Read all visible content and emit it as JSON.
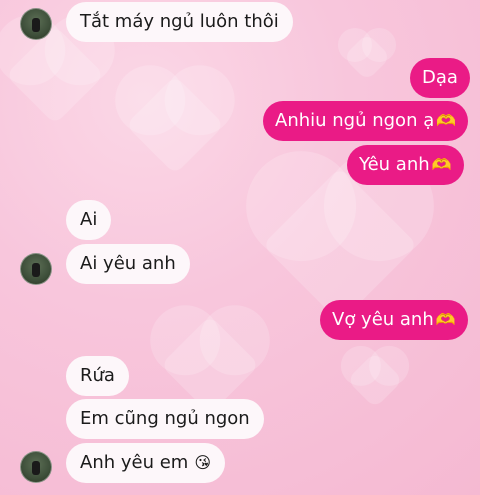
{
  "messages": [
    {
      "text": "Tắt máy ngủ luôn thôi",
      "side": "in"
    },
    {
      "text": "Dạa",
      "side": "out"
    },
    {
      "text": "Anhiu ngủ ngon ạ",
      "emoji": "🫶",
      "side": "out"
    },
    {
      "text": "Yêu anh",
      "emoji": "🫶",
      "side": "out"
    },
    {
      "text": "Ai",
      "side": "in"
    },
    {
      "text": "Ai yêu anh",
      "side": "in"
    },
    {
      "text": "Vợ yêu anh",
      "emoji": "🫶",
      "side": "out"
    },
    {
      "text": "Rứa",
      "side": "in"
    },
    {
      "text": "Em cũng ngủ ngon",
      "side": "in"
    },
    {
      "text": "Anh yêu em",
      "emoji": "😘",
      "side": "in"
    }
  ],
  "colors": {
    "outgoing_bubble": "#ea1b86",
    "incoming_bubble": "#fdf7fa",
    "background": "#f8c6dc"
  }
}
